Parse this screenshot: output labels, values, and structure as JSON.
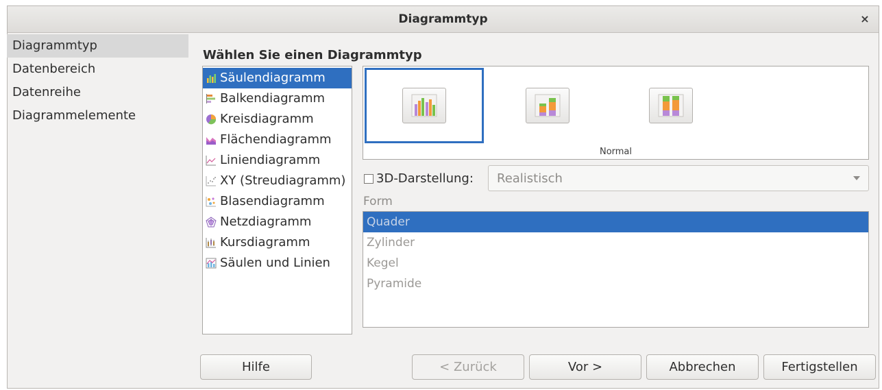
{
  "window": {
    "title": "Diagrammtyp",
    "close_glyph": "×"
  },
  "nav": {
    "items": [
      {
        "label": "Diagrammtyp",
        "active": true
      },
      {
        "label": "Datenbereich"
      },
      {
        "label": "Datenreihe"
      },
      {
        "label": "Diagrammelemente"
      }
    ]
  },
  "main": {
    "heading": "Wählen Sie einen Diagrammtyp",
    "chart_types": [
      {
        "label": "Säulendiagramm",
        "icon": "column-chart-icon",
        "selected": true
      },
      {
        "label": "Balkendiagramm",
        "icon": "bar-chart-icon"
      },
      {
        "label": "Kreisdiagramm",
        "icon": "pie-chart-icon"
      },
      {
        "label": "Flächendiagramm",
        "icon": "area-chart-icon"
      },
      {
        "label": "Liniendiagramm",
        "icon": "line-chart-icon"
      },
      {
        "label": "XY (Streudiagramm)",
        "icon": "scatter-chart-icon"
      },
      {
        "label": "Blasendiagramm",
        "icon": "bubble-chart-icon"
      },
      {
        "label": "Netzdiagramm",
        "icon": "net-chart-icon"
      },
      {
        "label": "Kursdiagramm",
        "icon": "stock-chart-icon"
      },
      {
        "label": "Säulen und Linien",
        "icon": "column-line-chart-icon"
      }
    ],
    "variants": {
      "caption": "Normal",
      "items": [
        {
          "name": "normal-column-icon",
          "selected": true
        },
        {
          "name": "stacked-column-icon"
        },
        {
          "name": "percent-stacked-column-icon"
        }
      ]
    },
    "three_d": {
      "label": "3D-Darstellung:",
      "checked": false,
      "select_value": "Realistisch"
    },
    "form": {
      "label": "Form",
      "items": [
        {
          "label": "Quader",
          "selected": true
        },
        {
          "label": "Zylinder"
        },
        {
          "label": "Kegel"
        },
        {
          "label": "Pyramide"
        }
      ]
    }
  },
  "buttons": {
    "help": "Hilfe",
    "back": "< Zurück",
    "next": "Vor >",
    "cancel": "Abbrechen",
    "finish": "Fertigstellen"
  },
  "colors": {
    "accent": "#2f6fc0",
    "dialog_bg": "#f2f1f0"
  }
}
